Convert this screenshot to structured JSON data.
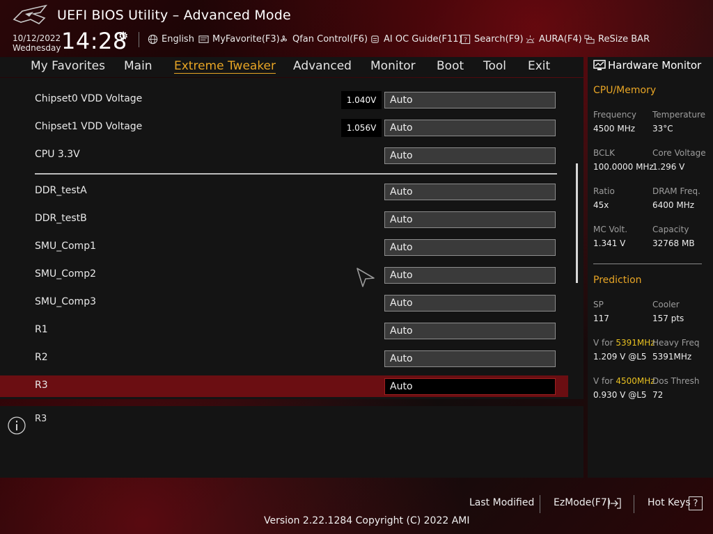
{
  "header": {
    "title": "UEFI BIOS Utility – Advanced Mode",
    "date": "10/12/2022",
    "day": "Wednesday",
    "time": "14:28",
    "toolbar": [
      {
        "label": "English",
        "icon": "globe-icon"
      },
      {
        "label": "MyFavorite(F3)",
        "icon": "favorite-icon"
      },
      {
        "label": "Qfan Control(F6)",
        "icon": "fan-icon"
      },
      {
        "label": "AI OC Guide(F11)",
        "icon": "ai-chip-icon"
      },
      {
        "label": "Search(F9)",
        "icon": "search-help-icon"
      },
      {
        "label": "AURA(F4)",
        "icon": "aura-light-icon"
      },
      {
        "label": "ReSize BAR",
        "icon": "resize-bar-icon"
      }
    ]
  },
  "tabs": [
    "My Favorites",
    "Main",
    "Extreme Tweaker",
    "Advanced",
    "Monitor",
    "Boot",
    "Tool",
    "Exit"
  ],
  "active_tab": "Extreme Tweaker",
  "settings": [
    {
      "label": "Chipset0 VDD Voltage",
      "reading": "1.040V",
      "value": "Auto"
    },
    {
      "label": "Chipset1 VDD Voltage",
      "reading": "1.056V",
      "value": "Auto"
    },
    {
      "label": "CPU 3.3V",
      "value": "Auto"
    },
    {
      "label": "DDR_testA",
      "value": "Auto"
    },
    {
      "label": "DDR_testB",
      "value": "Auto"
    },
    {
      "label": "SMU_Comp1",
      "value": "Auto"
    },
    {
      "label": "SMU_Comp2",
      "value": "Auto"
    },
    {
      "label": "SMU_Comp3",
      "value": "Auto"
    },
    {
      "label": "R1",
      "value": "Auto"
    },
    {
      "label": "R2",
      "value": "Auto"
    },
    {
      "label": "R3",
      "value": "Auto",
      "selected": true
    }
  ],
  "help_text": "R3",
  "hardware_monitor": {
    "title": "Hardware Monitor",
    "cpu_memory": {
      "heading": "CPU/Memory",
      "items": [
        {
          "label": "Frequency",
          "value": "4500 MHz"
        },
        {
          "label": "Temperature",
          "value": "33°C"
        },
        {
          "label": "BCLK",
          "value": "100.0000 MHz"
        },
        {
          "label": "Core Voltage",
          "value": "1.296 V"
        },
        {
          "label": "Ratio",
          "value": "45x"
        },
        {
          "label": "DRAM Freq.",
          "value": "6400 MHz"
        },
        {
          "label": "MC Volt.",
          "value": "1.341 V"
        },
        {
          "label": "Capacity",
          "value": "32768 MB"
        }
      ]
    },
    "prediction": {
      "heading": "Prediction",
      "sp_label": "SP",
      "sp_value": "117",
      "cooler_label": "Cooler",
      "cooler_value": "157 pts",
      "v1_prefix": "V for ",
      "v1_freq": "5391MHz",
      "v1_value": "1.209 V @L5",
      "heavy_label": "Heavy Freq",
      "heavy_value": "5391MHz",
      "v2_prefix": "V for ",
      "v2_freq": "4500MHz",
      "v2_value": "0.930 V @L5",
      "dos_label": "Dos Thresh",
      "dos_value": "72"
    }
  },
  "footer": {
    "last_modified": "Last Modified",
    "ezmode": "EzMode(F7)",
    "hotkeys": "Hot Keys",
    "hotkeys_glyph": "?",
    "version": "Version 2.22.1284 Copyright (C) 2022 AMI"
  },
  "colors": {
    "accent": "#e8a525",
    "selection": "#6b0e12",
    "highlight": "#e8c020"
  }
}
